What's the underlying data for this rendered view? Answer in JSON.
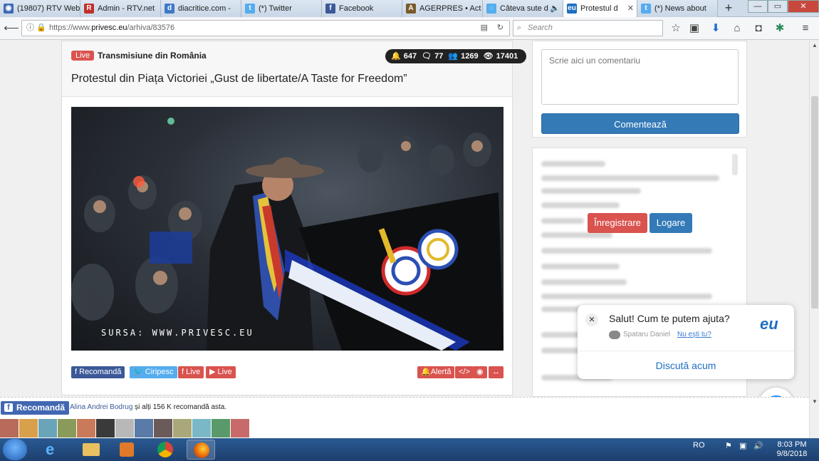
{
  "tabs": [
    {
      "label": "(19807) RTV Web",
      "color": "#3d6ab3"
    },
    {
      "label": "Admin - RTV.net",
      "color": "#c0302a"
    },
    {
      "label": "diacritice.com -",
      "color": "#3f79c8"
    },
    {
      "label": "(*) Twitter",
      "color": "#55acee"
    },
    {
      "label": "Facebook",
      "color": "#3b5998"
    },
    {
      "label": "AGERPRES • Act",
      "color": "#7a5a2a"
    },
    {
      "label": "Câteva sute d",
      "color": "#55acee"
    },
    {
      "label": "Protestul d",
      "color": "#1d6fc2"
    },
    {
      "label": "(*) News about",
      "color": "#55acee"
    }
  ],
  "url": {
    "scheme": "https://www.",
    "domain": "privesc.eu",
    "path": "/arhiva/83576"
  },
  "search_placeholder": "Search",
  "header": {
    "live_badge": "Live",
    "section": "Transmisiune din România",
    "stats": {
      "notifications": "647",
      "comments": "77",
      "users": "1269",
      "views": "17401"
    },
    "title": "Protestul din Piața Victoriei „Gust de libertate/A Taste for Freedom”"
  },
  "video": {
    "watermark": "SURSA: WWW.PRIVESC.EU"
  },
  "share": {
    "recommend": "Recomandă",
    "tweet": "Ciripesc",
    "live_f": "Live",
    "live_yt": "Live",
    "alert": "Alertă"
  },
  "comment": {
    "placeholder": "Scrie aici un comentariu",
    "submit": "Comentează"
  },
  "auth": {
    "register": "Înregistrare",
    "login": "Logare"
  },
  "chat": {
    "greeting": "Salut! Cum te putem ajuta?",
    "agent": "Spataru Daniel",
    "not_you": "Nu ești tu?",
    "brand": "eu",
    "cta": "Discută acum"
  },
  "reco": {
    "button": "Recomandă",
    "name": "Alina Andrei Bodrug",
    "text": " și alți 156 K recomandă asta."
  },
  "taskbar": {
    "lang": "RO",
    "time": "8:03 PM",
    "date": "9/8/2018"
  }
}
